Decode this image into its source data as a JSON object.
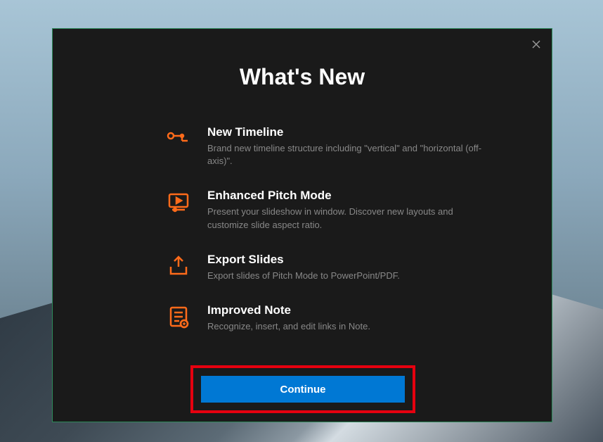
{
  "dialog": {
    "title": "What's New",
    "closeLabel": "Close"
  },
  "features": [
    {
      "icon": "timeline-icon",
      "title": "New Timeline",
      "description": "Brand new timeline structure including \"vertical\" and \"horizontal (off-axis)\"."
    },
    {
      "icon": "play-screen-icon",
      "title": "Enhanced Pitch Mode",
      "description": "Present your slideshow in window. Discover new layouts and customize slide aspect ratio."
    },
    {
      "icon": "export-icon",
      "title": "Export Slides",
      "description": "Export slides of Pitch Mode to PowerPoint/PDF."
    },
    {
      "icon": "note-icon",
      "title": "Improved Note",
      "description": "Recognize, insert, and edit links in Note."
    }
  ],
  "button": {
    "continue": "Continue"
  }
}
